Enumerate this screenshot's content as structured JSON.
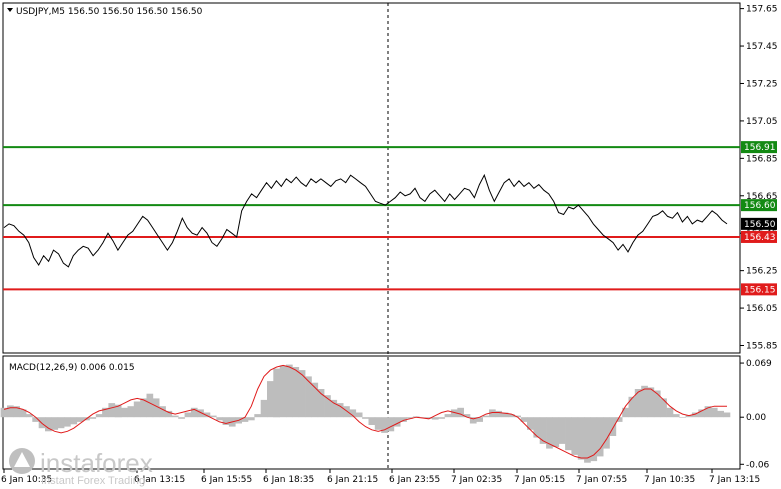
{
  "chart_data": [
    {
      "type": "line",
      "title": "USDJPY,M5  156.50 156.50 156.50 156.50",
      "symbol": "USDJPY,M5",
      "ohlc": [
        "156.50",
        "156.50",
        "156.50",
        "156.50"
      ],
      "ylim": [
        155.81,
        157.68
      ],
      "y_ticks": [
        "157.65",
        "157.45",
        "157.25",
        "157.05",
        "156.85",
        "156.65",
        "156.45",
        "156.25",
        "156.05",
        "155.85"
      ],
      "y_tick_values": [
        157.65,
        157.45,
        157.25,
        157.05,
        156.85,
        156.65,
        156.45,
        156.25,
        156.05,
        155.85
      ],
      "x_ticks": [
        "6 Jan 10:35",
        "6 Jan 13:15",
        "6 Jan 15:55",
        "6 Jan 18:35",
        "6 Jan 21:15",
        "6 Jan 23:55",
        "7 Jan 02:35",
        "7 Jan 05:15",
        "7 Jan 07:55",
        "7 Jan 10:35",
        "7 Jan 13:15"
      ],
      "levels": [
        {
          "value": 156.91,
          "label": "156.91",
          "color": "#138a13"
        },
        {
          "value": 156.6,
          "label": "156.60",
          "color": "#138a13"
        },
        {
          "value": 156.43,
          "label": "156.43",
          "color": "#e01b1b"
        },
        {
          "value": 156.15,
          "label": "156.15",
          "color": "#e01b1b"
        }
      ],
      "current_price": {
        "value": 156.5,
        "label": "156.50"
      },
      "series": [
        {
          "values": [
            156.48,
            156.5,
            156.49,
            156.46,
            156.44,
            156.4,
            156.32,
            156.28,
            156.33,
            156.3,
            156.36,
            156.34,
            156.29,
            156.27,
            156.33,
            156.36,
            156.38,
            156.37,
            156.33,
            156.36,
            156.4,
            156.45,
            156.41,
            156.36,
            156.4,
            156.44,
            156.46,
            156.5,
            156.54,
            156.52,
            156.48,
            156.44,
            156.4,
            156.36,
            156.4,
            156.46,
            156.53,
            156.48,
            156.45,
            156.44,
            156.48,
            156.45,
            156.4,
            156.38,
            156.42,
            156.47,
            156.45,
            156.43,
            156.57,
            156.62,
            156.66,
            156.64,
            156.68,
            156.72,
            156.69,
            156.73,
            156.7,
            156.74,
            156.72,
            156.75,
            156.72,
            156.7,
            156.74,
            156.72,
            156.74,
            156.72,
            156.7,
            156.73,
            156.74,
            156.72,
            156.76,
            156.74,
            156.72,
            156.7,
            156.66,
            156.62,
            156.61,
            156.6,
            156.62,
            156.64,
            156.67,
            156.65,
            156.66,
            156.69,
            156.64,
            156.62,
            156.66,
            156.68,
            156.65,
            156.62,
            156.66,
            156.63,
            156.66,
            156.69,
            156.68,
            156.64,
            156.71,
            156.76,
            156.68,
            156.62,
            156.67,
            156.72,
            156.74,
            156.7,
            156.73,
            156.7,
            156.72,
            156.69,
            156.71,
            156.68,
            156.66,
            156.62,
            156.56,
            156.55,
            156.59,
            156.58,
            156.6,
            156.57,
            156.54,
            156.5,
            156.47,
            156.44,
            156.42,
            156.4,
            156.36,
            156.39,
            156.35,
            156.4,
            156.44,
            156.46,
            156.5,
            156.54,
            156.55,
            156.57,
            156.54,
            156.53,
            156.56,
            156.51,
            156.54,
            156.5,
            156.52,
            156.51,
            156.54,
            156.57,
            156.55,
            156.52,
            156.5
          ]
        }
      ]
    },
    {
      "type": "bar",
      "title": "MACD(12,26,9) 0.006 0.015",
      "y_ticks": [
        "0.069",
        "0.00",
        "-0.06"
      ],
      "y_tick_values": [
        0.069,
        0.0,
        -0.06
      ],
      "ylim": [
        -0.066,
        0.078
      ],
      "series": [
        {
          "name": "MACD",
          "values": [
            0.012,
            0.015,
            0.014,
            0.01,
            0.004,
            -0.006,
            -0.014,
            -0.018,
            -0.016,
            -0.014,
            -0.012,
            -0.009,
            -0.006,
            -0.004,
            -0.002,
            0.004,
            0.012,
            0.018,
            0.016,
            0.012,
            0.014,
            0.02,
            0.024,
            0.03,
            0.024,
            0.014,
            0.008,
            0.002,
            -0.002,
            0.006,
            0.012,
            0.01,
            0.006,
            0.002,
            -0.004,
            -0.01,
            -0.012,
            -0.008,
            -0.006,
            -0.004,
            0.004,
            0.022,
            0.046,
            0.062,
            0.066,
            0.067,
            0.064,
            0.06,
            0.052,
            0.044,
            0.036,
            0.028,
            0.022,
            0.018,
            0.014,
            0.01,
            0.006,
            -0.002,
            -0.01,
            -0.016,
            -0.02,
            -0.018,
            -0.012,
            -0.006,
            -0.002,
            0.001,
            0.0,
            -0.002,
            -0.003,
            -0.002,
            0.004,
            0.01,
            0.012,
            0.004,
            -0.008,
            -0.006,
            0.002,
            0.01,
            0.008,
            0.006,
            0.004,
            0.002,
            -0.006,
            -0.016,
            -0.026,
            -0.034,
            -0.04,
            -0.038,
            -0.034,
            -0.042,
            -0.048,
            -0.054,
            -0.058,
            -0.056,
            -0.05,
            -0.04,
            -0.024,
            -0.006,
            0.012,
            0.026,
            0.036,
            0.04,
            0.038,
            0.034,
            0.024,
            0.012,
            0.004,
            0.0,
            0.002,
            0.006,
            0.01,
            0.014,
            0.012,
            0.008,
            0.006
          ]
        },
        {
          "name": "Signal",
          "values": [
            0.01,
            0.012,
            0.012,
            0.01,
            0.006,
            0.0,
            -0.008,
            -0.014,
            -0.018,
            -0.02,
            -0.018,
            -0.014,
            -0.008,
            -0.002,
            0.004,
            0.008,
            0.01,
            0.012,
            0.014,
            0.018,
            0.022,
            0.024,
            0.022,
            0.018,
            0.014,
            0.01,
            0.006,
            0.004,
            0.006,
            0.008,
            0.01,
            0.006,
            0.002,
            -0.002,
            -0.006,
            -0.008,
            -0.006,
            -0.004,
            0.0,
            0.014,
            0.036,
            0.052,
            0.06,
            0.064,
            0.066,
            0.064,
            0.06,
            0.054,
            0.046,
            0.038,
            0.03,
            0.024,
            0.018,
            0.014,
            0.008,
            0.002,
            -0.006,
            -0.012,
            -0.016,
            -0.018,
            -0.016,
            -0.012,
            -0.008,
            -0.004,
            -0.002,
            0.0,
            -0.001,
            -0.002,
            0.002,
            0.006,
            0.008,
            0.006,
            0.004,
            0.0,
            -0.002,
            0.0,
            0.004,
            0.006,
            0.006,
            0.005,
            0.004,
            0.0,
            -0.008,
            -0.016,
            -0.024,
            -0.03,
            -0.034,
            -0.038,
            -0.042,
            -0.046,
            -0.05,
            -0.052,
            -0.052,
            -0.048,
            -0.04,
            -0.028,
            -0.014,
            0.0,
            0.014,
            0.024,
            0.032,
            0.036,
            0.036,
            0.03,
            0.022,
            0.014,
            0.008,
            0.004,
            0.002,
            0.004,
            0.008,
            0.012,
            0.014,
            0.014,
            0.014
          ]
        }
      ]
    }
  ],
  "watermark": {
    "brand": "instaforex",
    "tagline": "Instant Forex Trading"
  },
  "colors": {
    "green": "#138a13",
    "red": "#e01b1b",
    "price": "#000000",
    "macd_bars": "#bdbdbd",
    "signal": "#e01b1b",
    "current_tag": "#000000"
  }
}
